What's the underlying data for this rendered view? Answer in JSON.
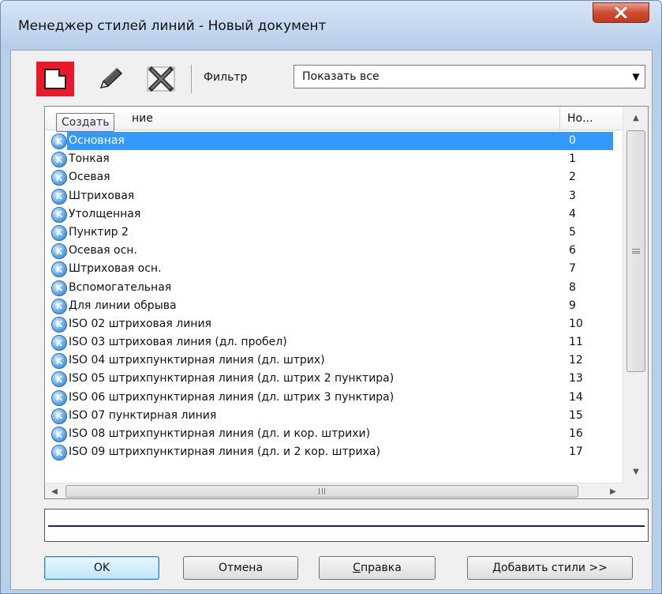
{
  "window": {
    "title": "Менеджер стилей линий - Новый документ",
    "close_label": "X"
  },
  "toolbar": {
    "new_tooltip": "Создать",
    "filter_label": "Фильтр",
    "filter_value": "Показать все"
  },
  "list": {
    "columns": {
      "name_tail": "ние",
      "number": "Но..."
    },
    "icon_letter": "K",
    "rows": [
      {
        "name": "Основная",
        "num": "0",
        "selected": true
      },
      {
        "name": "Тонкая",
        "num": "1"
      },
      {
        "name": "Осевая",
        "num": "2"
      },
      {
        "name": "Штриховая",
        "num": "3"
      },
      {
        "name": "Утолщенная",
        "num": "4"
      },
      {
        "name": "Пунктир 2",
        "num": "5"
      },
      {
        "name": "Осевая осн.",
        "num": "6"
      },
      {
        "name": "Штриховая осн.",
        "num": "7"
      },
      {
        "name": "Вспомогательная",
        "num": "8"
      },
      {
        "name": "Для линии обрыва",
        "num": "9"
      },
      {
        "name": "ISO 02 штриховая линия",
        "num": "10"
      },
      {
        "name": "ISO 03 штриховая линия (дл. пробел)",
        "num": "11"
      },
      {
        "name": "ISO 04 штрихпунктирная линия (дл. штрих)",
        "num": "12"
      },
      {
        "name": "ISO 05 штрихпунктирная линия (дл. штрих 2 пунктира)",
        "num": "13"
      },
      {
        "name": "ISO 06 штрихпунктирная линия (дл. штрих 3 пунктира)",
        "num": "14"
      },
      {
        "name": "ISO 07 пунктирная линия",
        "num": "15"
      },
      {
        "name": "ISO 08 штрихпунктирная линия (дл. и кор. штрихи)",
        "num": "16"
      },
      {
        "name": "ISO 09 штрихпунктирная линия (дл. и 2 кор. штриха)",
        "num": "17"
      }
    ]
  },
  "buttons": {
    "ok": "OK",
    "cancel": "Отмена",
    "help_accel": "С",
    "help_rest": "правка",
    "add_styles": "Добавить стили >>"
  },
  "colors": {
    "selection": "#3399ff",
    "new_button_highlight": "#e8192a",
    "preview_line": "#1c1c8c"
  }
}
